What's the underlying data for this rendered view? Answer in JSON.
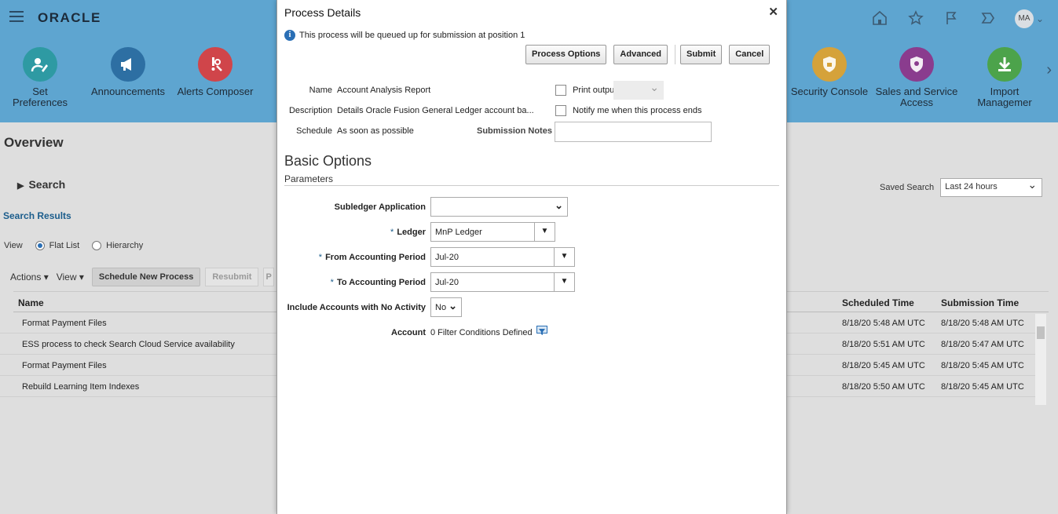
{
  "header": {
    "logo": "ORACLE",
    "springboard": [
      {
        "label": "Set Preferences",
        "icon": "set-preferences-icon",
        "color": "#2e9aa3"
      },
      {
        "label": "Announcements",
        "icon": "megaphone-icon",
        "color": "#2d6fa3"
      },
      {
        "label": "Alerts Composer",
        "icon": "alert-wrench-icon",
        "color": "#d0454a"
      },
      {
        "label": "Security Console",
        "icon": "shield-lock-icon",
        "color": "#d5a23a"
      },
      {
        "label": "Sales and Service Access",
        "icon": "shield-key-icon",
        "color": "#8a3c8e"
      },
      {
        "label": "Import Managemer",
        "icon": "download-icon",
        "color": "#4ca34b"
      }
    ],
    "avatar": "MA"
  },
  "page": {
    "overview": "Overview",
    "search": "Search",
    "search_results": "Search Results",
    "view_label": "View",
    "flat_list": "Flat List",
    "hierarchy": "Hierarchy",
    "actions": "Actions",
    "view_menu": "View",
    "schedule_new": "Schedule New Process",
    "resubmit": "Resubmit",
    "put_on_hold": "P",
    "saved_search_label": "Saved Search",
    "saved_search_value": "Last 24 hours",
    "columns": {
      "name": "Name",
      "scheduled": "Scheduled Time",
      "submission": "Submission Time"
    },
    "rows": [
      {
        "name": "Format Payment Files",
        "scheduled": "8/18/20 5:48 AM UTC",
        "submission": "8/18/20 5:48 AM UTC"
      },
      {
        "name": "ESS process to check Search Cloud Service availability",
        "scheduled": "8/18/20 5:51 AM UTC",
        "submission": "8/18/20 5:47 AM UTC"
      },
      {
        "name": "Format Payment Files",
        "scheduled": "8/18/20 5:45 AM UTC",
        "submission": "8/18/20 5:45 AM UTC"
      },
      {
        "name": "Rebuild Learning Item Indexes",
        "scheduled": "8/18/20 5:50 AM UTC",
        "submission": "8/18/20 5:45 AM UTC"
      }
    ]
  },
  "dialog": {
    "title": "Process Details",
    "info": "This process will be queued up for submission at position 1",
    "buttons": {
      "process_options": "Process Options",
      "advanced": "Advanced",
      "submit": "Submit",
      "cancel": "Cancel"
    },
    "name_label": "Name",
    "name_value": "Account Analysis Report",
    "description_label": "Description",
    "description_value": "Details Oracle Fusion General Ledger account ba...",
    "schedule_label": "Schedule",
    "schedule_value": "As soon as possible",
    "print_output": "Print output",
    "notify": "Notify me when this process ends",
    "submission_notes": "Submission Notes",
    "basic_options": "Basic Options",
    "parameters": "Parameters",
    "params": {
      "subledger_label": "Subledger Application",
      "subledger_value": "",
      "ledger_label": "Ledger",
      "ledger_value": "MnP Ledger",
      "from_label": "From Accounting Period",
      "from_value": "Jul-20",
      "to_label": "To Accounting Period",
      "to_value": "Jul-20",
      "include_label": "Include Accounts with No Activity",
      "include_value": "No",
      "account_label": "Account",
      "account_value": "0 Filter Conditions Defined"
    }
  }
}
